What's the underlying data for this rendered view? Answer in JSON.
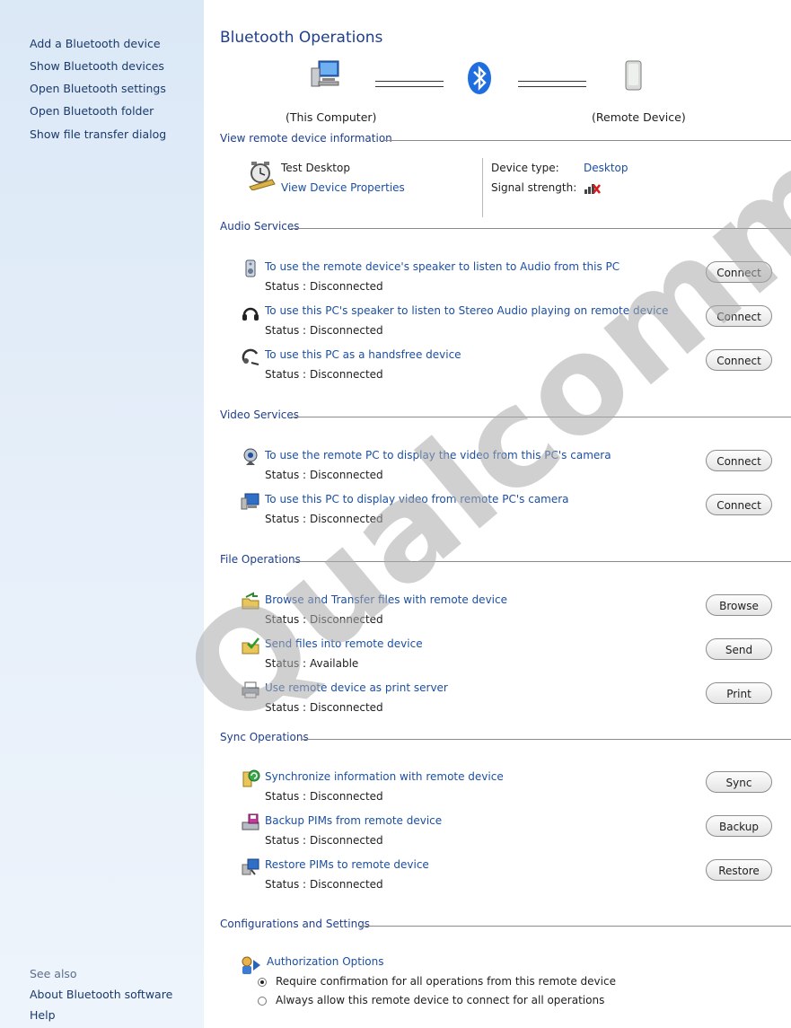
{
  "sidebar": {
    "tasks": [
      "Add a Bluetooth device",
      "Show Bluetooth devices",
      "Open Bluetooth settings",
      "Open Bluetooth folder",
      "Show file transfer dialog"
    ],
    "see_also_heading": "See also",
    "see_also": [
      "About Bluetooth software",
      "Help"
    ]
  },
  "main": {
    "title": "Bluetooth Operations",
    "this_computer": "(This Computer)",
    "remote_device": "(Remote Device)"
  },
  "remote_info": {
    "heading": "View remote device information",
    "device_name": "Test Desktop",
    "properties_link": "View Device Properties",
    "device_type_label": "Device type:",
    "device_type_value": "Desktop",
    "signal_label": "Signal strength:"
  },
  "status_label": "Status :",
  "sections": {
    "audio": {
      "heading": "Audio Services",
      "items": [
        {
          "text": "To use the remote device's speaker to listen to Audio from this PC",
          "status": "Disconnected",
          "button": "Connect",
          "icon": "speaker-icon"
        },
        {
          "text": "To use this PC's speaker to listen to Stereo Audio playing on remote device",
          "status": "Disconnected",
          "button": "Connect",
          "icon": "headphones-icon"
        },
        {
          "text": "To use this PC as a handsfree device",
          "status": "Disconnected",
          "button": "Connect",
          "icon": "headset-icon"
        }
      ]
    },
    "video": {
      "heading": "Video Services",
      "items": [
        {
          "text": "To use the remote PC to display the video from this PC's camera",
          "status": "Disconnected",
          "button": "Connect",
          "icon": "webcam-icon"
        },
        {
          "text": "To use this PC to display video from remote PC's camera",
          "status": "Disconnected",
          "button": "Connect",
          "icon": "monitor-video-icon"
        }
      ]
    },
    "file": {
      "heading": "File Operations",
      "items": [
        {
          "text": "Browse and Transfer files with remote device",
          "status": "Disconnected",
          "button": "Browse",
          "icon": "folder-transfer-icon"
        },
        {
          "text": "Send files into remote device",
          "status": "Available",
          "button": "Send",
          "icon": "folder-send-icon"
        },
        {
          "text": "Use remote device as print server",
          "status": "Disconnected",
          "button": "Print",
          "icon": "printer-icon"
        }
      ]
    },
    "sync": {
      "heading": "Sync Operations",
      "items": [
        {
          "text": "Synchronize information with remote device",
          "status": "Disconnected",
          "button": "Sync",
          "icon": "sync-icon"
        },
        {
          "text": "Backup PIMs from remote device",
          "status": "Disconnected",
          "button": "Backup",
          "icon": "backup-icon"
        },
        {
          "text": "Restore PIMs to remote device",
          "status": "Disconnected",
          "button": "Restore",
          "icon": "restore-icon"
        }
      ]
    }
  },
  "config": {
    "heading": "Configurations and Settings",
    "auth_link": "Authorization Options",
    "options": [
      "Require confirmation for all operations from this remote device",
      "Always allow this remote device to connect for all operations"
    ],
    "selected": 0
  },
  "watermark": "Qualcomm Atheros Confidential",
  "colors": {
    "link": "#1c4fa0",
    "heading": "#1e3e8c",
    "sidebar": "#dbe8f6"
  }
}
